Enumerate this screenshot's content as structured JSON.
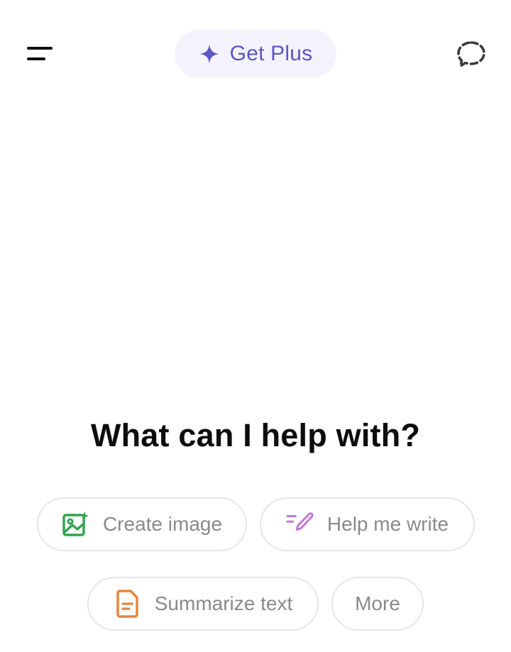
{
  "header": {
    "get_plus_label": "Get Plus",
    "icons": {
      "menu": "menu-icon",
      "sparkle": "sparkle-icon",
      "temporary_chat": "temporary-chat-icon"
    },
    "accent_color": "#5b55c9"
  },
  "main": {
    "headline": "What can I help with?"
  },
  "suggestions": [
    {
      "label": "Create image",
      "icon": "image-icon",
      "color": "#2ea44f"
    },
    {
      "label": "Help me write",
      "icon": "pen-icon",
      "color": "#c57bd9"
    },
    {
      "label": "Summarize text",
      "icon": "document-icon",
      "color": "#e8843c"
    },
    {
      "label": "More",
      "icon": "",
      "color": "#8a8a8a"
    }
  ]
}
